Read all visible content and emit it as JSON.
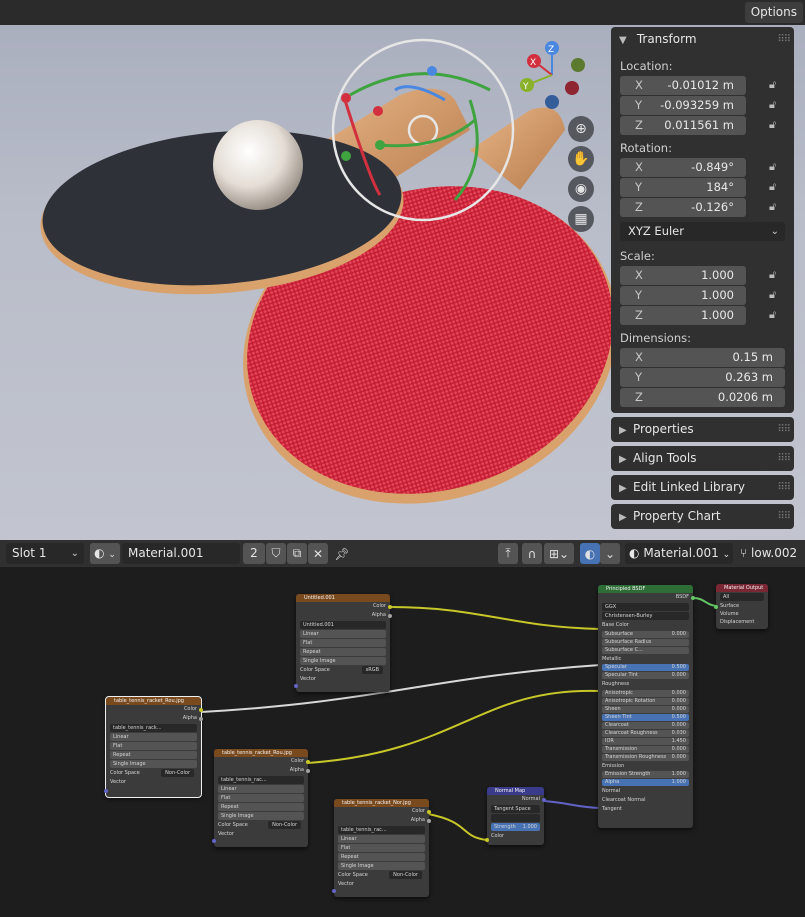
{
  "header": {
    "options_label": "Options"
  },
  "npanel": {
    "transform": {
      "title": "Transform",
      "location_label": "Location:",
      "location": [
        {
          "axis": "X",
          "value": "-0.01012 m"
        },
        {
          "axis": "Y",
          "value": "-0.093259 m"
        },
        {
          "axis": "Z",
          "value": "0.011561 m"
        }
      ],
      "rotation_label": "Rotation:",
      "rotation": [
        {
          "axis": "X",
          "value": "-0.849°"
        },
        {
          "axis": "Y",
          "value": "184°"
        },
        {
          "axis": "Z",
          "value": "-0.126°"
        }
      ],
      "rotation_mode": "XYZ Euler",
      "scale_label": "Scale:",
      "scale": [
        {
          "axis": "X",
          "value": "1.000"
        },
        {
          "axis": "Y",
          "value": "1.000"
        },
        {
          "axis": "Z",
          "value": "1.000"
        }
      ],
      "dimensions_label": "Dimensions:",
      "dimensions": [
        {
          "axis": "X",
          "value": "0.15 m"
        },
        {
          "axis": "Y",
          "value": "0.263 m"
        },
        {
          "axis": "Z",
          "value": "0.0206 m"
        }
      ]
    },
    "collapsed_panels": [
      "Properties",
      "Align Tools",
      "Edit Linked Library",
      "Property Chart"
    ]
  },
  "shader_header": {
    "slot": "Slot 1",
    "material_name": "Material.001",
    "user_count": "2",
    "right_material": "Material.001",
    "object_name": "low.002"
  },
  "gizmo": {
    "axis_labels": {
      "x": "X",
      "y": "Y",
      "z": "Z"
    }
  },
  "nodes": {
    "tex1": {
      "title": "table_tennis_racket_Rou.jpg",
      "outputs": [
        "Color",
        "Alpha"
      ],
      "image": "table_tennis_rack...",
      "rows": [
        "Linear",
        "Flat",
        "Repeat",
        "Single Image"
      ],
      "color_space_label": "Color Space",
      "color_space": "Non-Color",
      "vector": "Vector"
    },
    "tex2": {
      "title": "table_tennis_racket_Rou.jpg",
      "outputs": [
        "Color",
        "Alpha"
      ],
      "image": "table_tennis_rac...",
      "rows": [
        "Linear",
        "Flat",
        "Repeat",
        "Single Image"
      ],
      "color_space_label": "Color Space",
      "color_space": "Non-Color",
      "vector": "Vector"
    },
    "tex3": {
      "title": "Untitled.001",
      "outputs": [
        "Color",
        "Alpha"
      ],
      "image": "Untitled.001",
      "rows": [
        "Linear",
        "Flat",
        "Repeat",
        "Single Image"
      ],
      "color_space_label": "Color Space",
      "color_space": "sRGB",
      "vector": "Vector"
    },
    "tex4": {
      "title": "table_tennis_racket_Nor.jpg",
      "outputs": [
        "Color",
        "Alpha"
      ],
      "image": "table_tennis_rac...",
      "rows": [
        "Linear",
        "Flat",
        "Repeat",
        "Single Image"
      ],
      "color_space_label": "Color Space",
      "color_space": "Non-Color",
      "vector": "Vector"
    },
    "normal_map": {
      "title": "Normal Map",
      "output": "Normal",
      "space": "Tangent Space",
      "strength_label": "Strength",
      "strength": "1.000",
      "color": "Color"
    },
    "bsdf": {
      "title": "Principled BSDF",
      "output": "BSDF",
      "distribution": "GGX",
      "subsurface_method": "Christensen-Burley",
      "inputs": [
        {
          "name": "Base Color",
          "value": ""
        },
        {
          "name": "Subsurface",
          "value": "0.000"
        },
        {
          "name": "Subsurface Radius",
          "value": ""
        },
        {
          "name": "Subsurface C...",
          "value": ""
        },
        {
          "name": "Metallic",
          "value": ""
        },
        {
          "name": "Specular",
          "value": "0.500"
        },
        {
          "name": "Specular Tint",
          "value": "0.000"
        },
        {
          "name": "Roughness",
          "value": ""
        },
        {
          "name": "Anisotropic",
          "value": "0.000"
        },
        {
          "name": "Anisotropic Rotation",
          "value": "0.000"
        },
        {
          "name": "Sheen",
          "value": "0.000"
        },
        {
          "name": "Sheen Tint",
          "value": "0.500"
        },
        {
          "name": "Clearcoat",
          "value": "0.000"
        },
        {
          "name": "Clearcoat Roughness",
          "value": "0.030"
        },
        {
          "name": "IOR",
          "value": "1.450"
        },
        {
          "name": "Transmission",
          "value": "0.000"
        },
        {
          "name": "Transmission Roughness",
          "value": "0.000"
        },
        {
          "name": "Emission",
          "value": ""
        },
        {
          "name": "Emission Strength",
          "value": "1.000"
        },
        {
          "name": "Alpha",
          "value": "1.000"
        },
        {
          "name": "Normal",
          "value": ""
        },
        {
          "name": "Clearcoat Normal",
          "value": ""
        },
        {
          "name": "Tangent",
          "value": ""
        }
      ]
    },
    "output": {
      "title": "Material Output",
      "target": "All",
      "inputs": [
        "Surface",
        "Volume",
        "Displacement"
      ]
    }
  }
}
